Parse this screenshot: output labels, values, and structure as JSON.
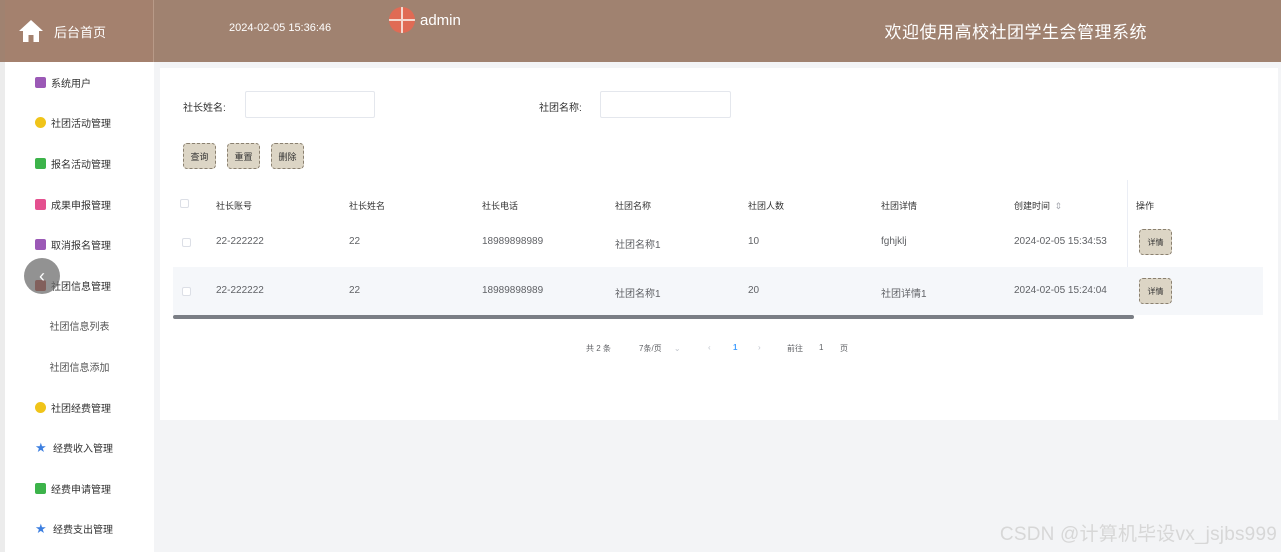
{
  "header": {
    "home_label": "后台首页",
    "datetime": "2024-02-05 15:36:46",
    "username": "admin",
    "welcome": "欢迎使用高校社团学生会管理系统"
  },
  "sidebar": {
    "items": [
      {
        "label": "系统用户",
        "icon": "user-icon"
      },
      {
        "label": "社团活动管理",
        "icon": "activity-icon"
      },
      {
        "label": "报名活动管理",
        "icon": "signup-icon"
      },
      {
        "label": "成果申报管理",
        "icon": "achievement-icon"
      },
      {
        "label": "取消报名管理",
        "icon": "cancel-icon"
      },
      {
        "label": "社团信息管理",
        "icon": "club-info-icon"
      },
      {
        "label": "社团信息列表",
        "icon": ""
      },
      {
        "label": "社团信息添加",
        "icon": ""
      },
      {
        "label": "社团经费管理",
        "icon": "funds-icon"
      },
      {
        "label": "经费收入管理",
        "icon": "star-icon"
      },
      {
        "label": "经费申请管理",
        "icon": "apply-icon"
      },
      {
        "label": "经费支出管理",
        "icon": "star-icon"
      }
    ]
  },
  "search": {
    "leader_name_label": "社长姓名:",
    "leader_name_value": "",
    "club_name_label": "社团名称:",
    "club_name_value": ""
  },
  "buttons": {
    "query": "查询",
    "reset": "重置",
    "delete": "删除"
  },
  "table": {
    "headers": [
      "社长账号",
      "社长姓名",
      "社长电话",
      "社团名称",
      "社团人数",
      "社团详情",
      "创建时间",
      "操作"
    ],
    "sort_indicator": "⇕",
    "detail_label": "详情",
    "rows": [
      {
        "account": "22-222222",
        "name": "22",
        "phone": "18989898989",
        "club": "社团名称1",
        "members": "10",
        "details": "fghjklj",
        "created": "2024-02-05 15:34:53"
      },
      {
        "account": "22-222222",
        "name": "22",
        "phone": "18989898989",
        "club": "社团名称1",
        "members": "20",
        "details": "社团详情1",
        "created": "2024-02-05 15:24:04"
      }
    ]
  },
  "pagination": {
    "total": "共 2 条",
    "page_size": "7条/页",
    "prev": "‹",
    "current": "1",
    "next": "›",
    "goto_label": "前往",
    "goto_value": "1",
    "page_suffix": "页"
  },
  "watermark": "CSDN @计算机毕设vx_jsjbs999",
  "colors": {
    "header_bg": "#a08270",
    "button_bg": "#dcd5c5",
    "accent": "#409eff"
  }
}
